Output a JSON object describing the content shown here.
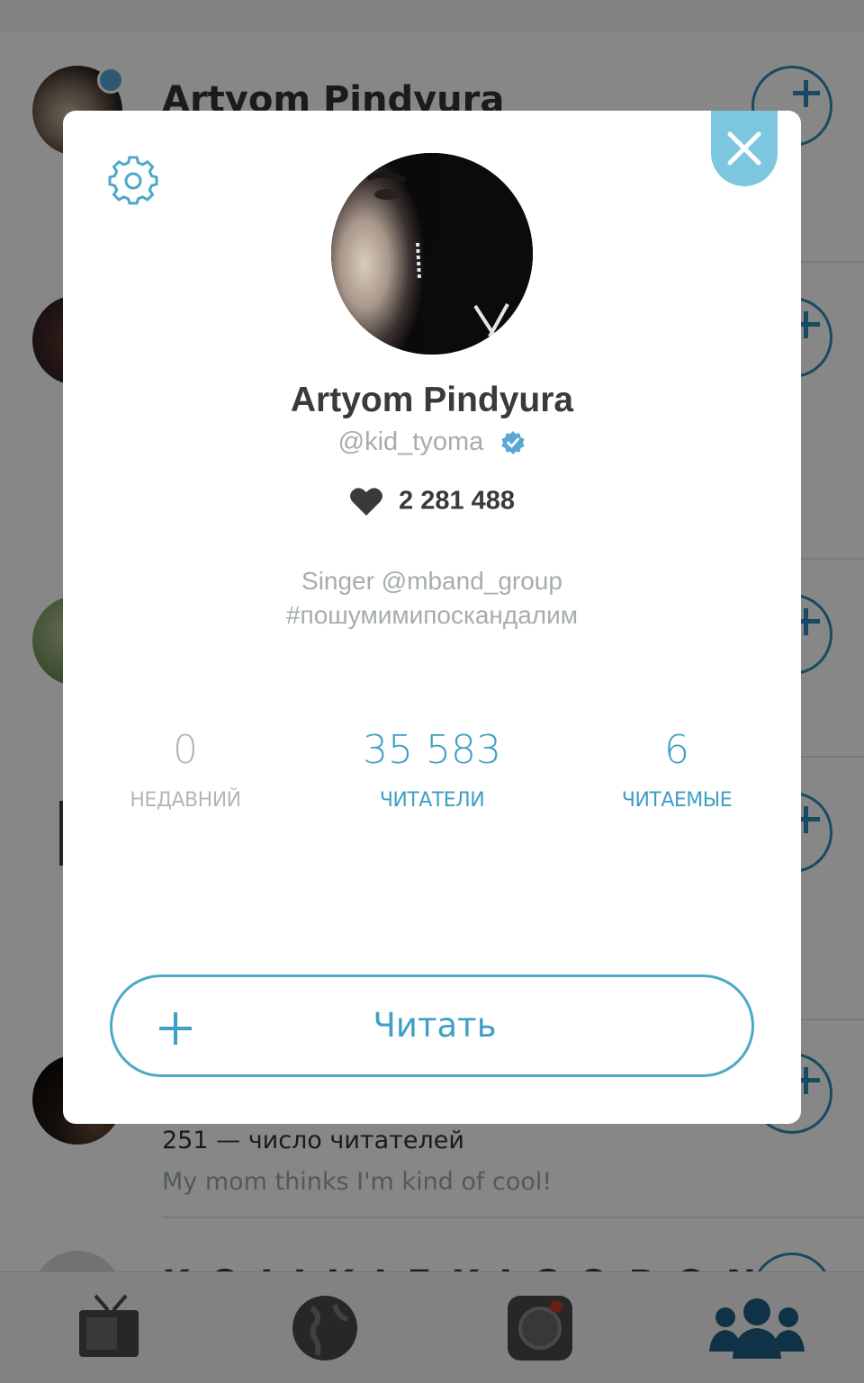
{
  "background_list": {
    "rows": [
      {
        "name": "Artyom Pindyura"
      },
      {
        "followers": "251 — число читателей",
        "bio": "My mom thinks I'm kind of cool!"
      },
      {
        "name": "K O I I K I E K I C O B O N"
      }
    ]
  },
  "tab_bar": {
    "tabs": [
      {
        "icon": "tv-icon"
      },
      {
        "icon": "globe-icon"
      },
      {
        "icon": "camera-icon"
      },
      {
        "icon": "people-icon"
      }
    ]
  },
  "profile_modal": {
    "name": "Artyom Pindyura",
    "handle": "@kid_tyoma",
    "verified": true,
    "likes": "2 281 488",
    "bio_lines": [
      "Singer @mband_group",
      "#пошумимипоскандалим"
    ],
    "stats": [
      {
        "value": "0",
        "label": "НЕДАВНИЙ"
      },
      {
        "value": "35 583",
        "label": "ЧИТАТЕЛИ"
      },
      {
        "value": "6",
        "label": "ЧИТАЕМЫЕ"
      }
    ],
    "follow_button_label": "Читать"
  },
  "colors": {
    "accent": "#3f9fc4",
    "close_button": "#7cc6df",
    "muted_text": "#a6acb0",
    "dark_text": "#3a3a3a",
    "verified": "#5aa7d6"
  }
}
